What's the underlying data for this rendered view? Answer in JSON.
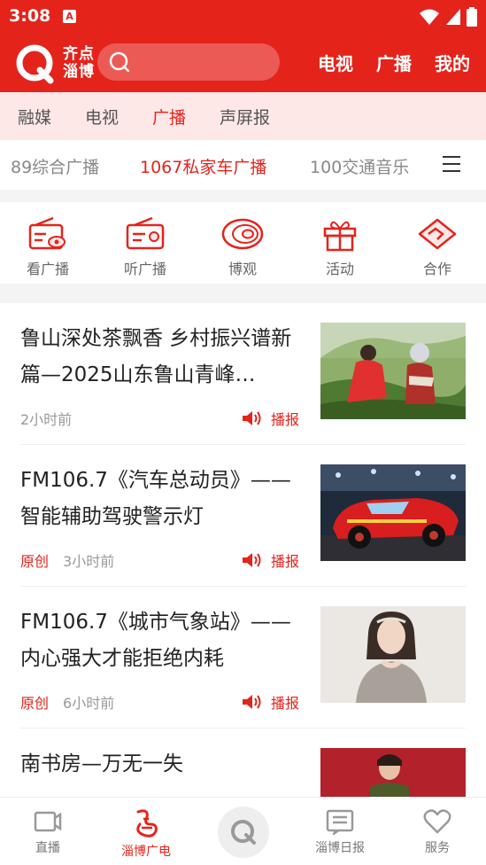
{
  "status": {
    "time": "3:08",
    "notif_icon": "A"
  },
  "header": {
    "logo_line1": "齐点",
    "logo_line2": "淄博",
    "nav": [
      "电视",
      "广播",
      "我的"
    ]
  },
  "category_tabs": [
    {
      "label": "融媒",
      "active": false
    },
    {
      "label": "电视",
      "active": false
    },
    {
      "label": "广播",
      "active": true
    },
    {
      "label": "声屏报",
      "active": false
    }
  ],
  "channel_tabs": [
    {
      "label": "89综合广播",
      "active": false
    },
    {
      "label": "1067私家车广播",
      "active": true
    },
    {
      "label": "100交通音乐",
      "active": false
    }
  ],
  "functions": [
    {
      "label": "看广播",
      "icon": "radio-watch-icon"
    },
    {
      "label": "听广播",
      "icon": "radio-listen-icon"
    },
    {
      "label": "博观",
      "icon": "boguan-icon"
    },
    {
      "label": "活动",
      "icon": "gift-icon"
    },
    {
      "label": "合作",
      "icon": "handshake-icon"
    }
  ],
  "news": [
    {
      "title": "鲁山深处茶飘香 乡村振兴谱新篇—2025山东鲁山青峰…",
      "original": "",
      "time": "2小时前",
      "speak": "播报",
      "thumb": "tea-harvest"
    },
    {
      "title": "FM106.7《汽车总动员》——智能辅助驾驶警示灯",
      "original": "原创",
      "time": "3小时前",
      "speak": "播报",
      "thumb": "race-car"
    },
    {
      "title": "FM106.7《城市气象站》——内心强大才能拒绝内耗",
      "original": "原创",
      "time": "6小时前",
      "speak": "播报",
      "thumb": "portrait"
    },
    {
      "title": "南书房—万无一失",
      "original": "",
      "time": "",
      "speak": "",
      "thumb": "family"
    }
  ],
  "bottom_nav": [
    {
      "label": "直播",
      "icon": "video-camera-icon",
      "active": false
    },
    {
      "label": "淄博广电",
      "icon": "zibo-tv-icon",
      "active": true
    },
    {
      "label": "淄博日报",
      "icon": "newspaper-icon",
      "active": false
    },
    {
      "label": "服务",
      "icon": "heart-icon",
      "active": false
    }
  ],
  "colors": {
    "brand_red": "#e4231b",
    "tab_bg": "#fde8e7",
    "gap_bg": "#f4f4f4"
  }
}
